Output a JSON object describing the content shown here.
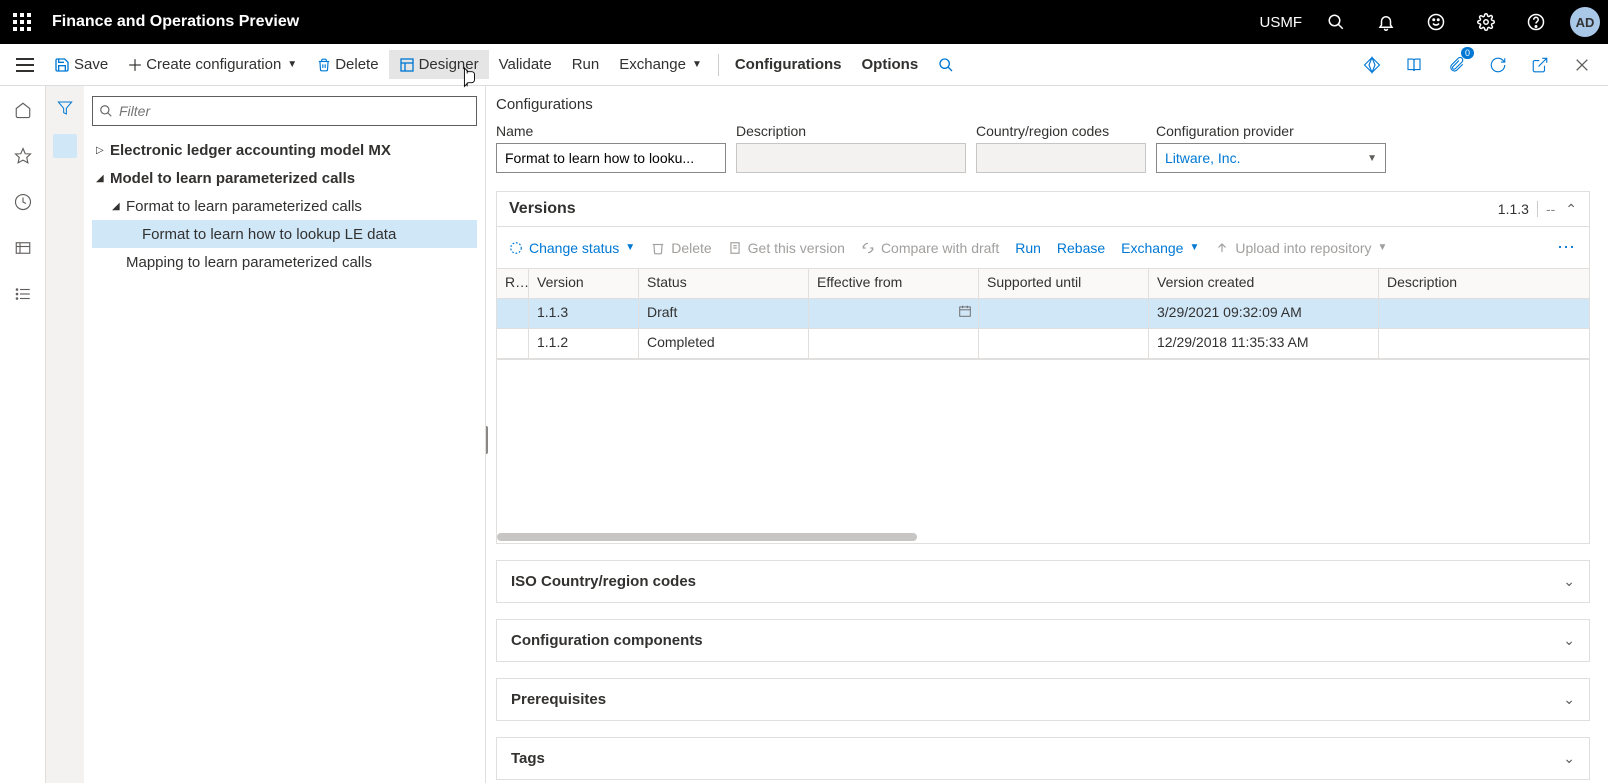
{
  "topbar": {
    "title": "Finance and Operations Preview",
    "company": "USMF",
    "avatar": "AD"
  },
  "actionbar": {
    "save": "Save",
    "create_config": "Create configuration",
    "delete": "Delete",
    "designer": "Designer",
    "validate": "Validate",
    "run": "Run",
    "exchange": "Exchange",
    "configurations": "Configurations",
    "options": "Options",
    "badge_count": "0"
  },
  "filter_placeholder": "Filter",
  "tree": {
    "n0": "Electronic ledger accounting model MX",
    "n1": "Model to learn parameterized calls",
    "n2": "Format to learn parameterized calls",
    "n3": "Format to learn how to lookup LE data",
    "n4": "Mapping to learn parameterized calls"
  },
  "config": {
    "heading": "Configurations",
    "labels": {
      "name": "Name",
      "description": "Description",
      "crc": "Country/region codes",
      "provider": "Configuration provider"
    },
    "values": {
      "name": "Format to learn how to looku...",
      "description": "",
      "crc": "",
      "provider": "Litware, Inc."
    }
  },
  "versions": {
    "title": "Versions",
    "badge": "1.1.3",
    "dash": "--",
    "toolbar": {
      "change_status": "Change status",
      "delete": "Delete",
      "get_version": "Get this version",
      "compare": "Compare with draft",
      "run": "Run",
      "rebase": "Rebase",
      "exchange": "Exchange",
      "upload": "Upload into repository"
    },
    "columns": {
      "r": "R...",
      "version": "Version",
      "status": "Status",
      "eff": "Effective from",
      "sup": "Supported until",
      "created": "Version created",
      "desc": "Description"
    },
    "rows": [
      {
        "version": "1.1.3",
        "status": "Draft",
        "eff": "",
        "sup": "",
        "created": "3/29/2021 09:32:09 AM",
        "desc": ""
      },
      {
        "version": "1.1.2",
        "status": "Completed",
        "eff": "",
        "sup": "",
        "created": "12/29/2018 11:35:33 AM",
        "desc": ""
      }
    ]
  },
  "sections": {
    "iso": "ISO Country/region codes",
    "components": "Configuration components",
    "prereq": "Prerequisites",
    "tags": "Tags"
  }
}
